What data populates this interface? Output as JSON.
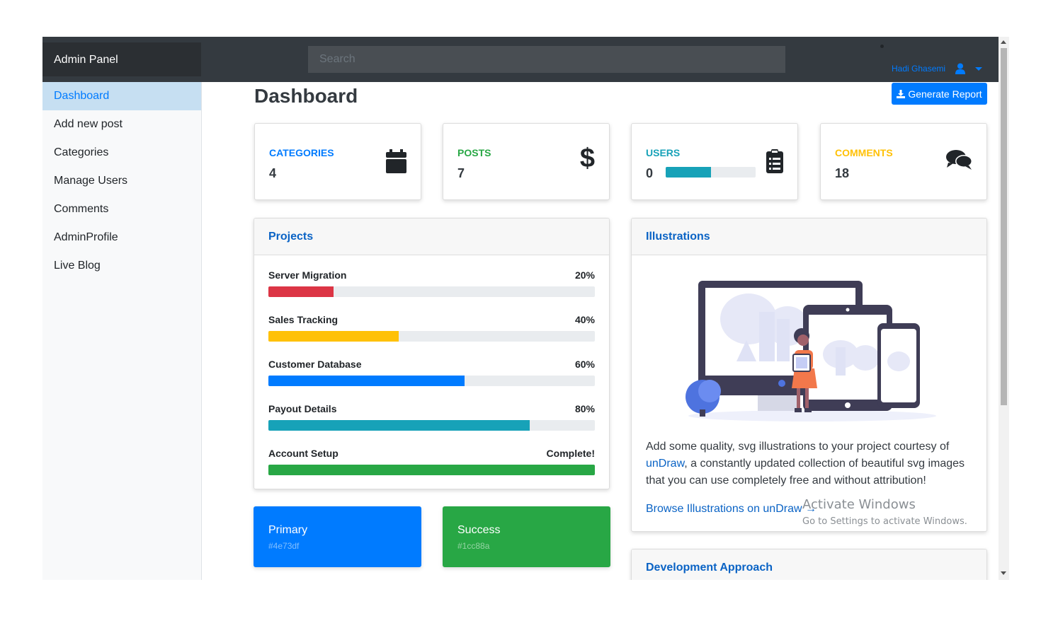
{
  "brand": "Admin Panel",
  "search": {
    "placeholder": "Search"
  },
  "user": {
    "name": "Hadi Ghasemi",
    "icon": "user-icon"
  },
  "sidebar": {
    "items": [
      {
        "label": "Dashboard",
        "active": true
      },
      {
        "label": "Add new post"
      },
      {
        "label": "Categories"
      },
      {
        "label": "Manage Users"
      },
      {
        "label": "Comments"
      },
      {
        "label": "AdminProfile"
      },
      {
        "label": "Live Blog"
      }
    ]
  },
  "page": {
    "title": "Dashboard",
    "generate_label": "Generate Report"
  },
  "stats": [
    {
      "label": "CATEGORIES",
      "value": "4",
      "color": "#007bff",
      "icon": "calendar-icon"
    },
    {
      "label": "POSTS",
      "value": "7",
      "color": "#28a745",
      "icon": "dollar-icon"
    },
    {
      "label": "USERS",
      "value": "0",
      "color": "#17a2b8",
      "icon": "clipboard-list-icon",
      "progress": 0.5
    },
    {
      "label": "COMMENTS",
      "value": "18",
      "color": "#ffc107",
      "icon": "comments-icon"
    }
  ],
  "projects": {
    "title": "Projects",
    "items": [
      {
        "name": "Server Migration",
        "value_label": "20%",
        "percent": 20,
        "color": "#dc3545"
      },
      {
        "name": "Sales Tracking",
        "value_label": "40%",
        "percent": 40,
        "color": "#ffc107"
      },
      {
        "name": "Customer Database",
        "value_label": "60%",
        "percent": 60,
        "color": "#007bff"
      },
      {
        "name": "Payout Details",
        "value_label": "80%",
        "percent": 80,
        "color": "#17a2b8"
      },
      {
        "name": "Account Setup",
        "value_label": "Complete!",
        "percent": 100,
        "color": "#28a745"
      }
    ]
  },
  "illustrations": {
    "title": "Illustrations",
    "text_before": "Add some quality, svg illustrations to your project courtesy of ",
    "link_text": "unDraw",
    "text_after": ", a constantly updated collection of beautiful svg images that you can use completely free and without attribution!",
    "browse_link": "Browse Illustrations on unDraw →"
  },
  "development": {
    "title": "Development Approach"
  },
  "color_cards": [
    {
      "name": "Primary",
      "hex": "#4e73df",
      "bg": "#007bff"
    },
    {
      "name": "Success",
      "hex": "#1cc88a",
      "bg": "#28a745"
    }
  ],
  "watermark": {
    "line1": "Activate Windows",
    "line2": "Go to Settings to activate Windows."
  }
}
